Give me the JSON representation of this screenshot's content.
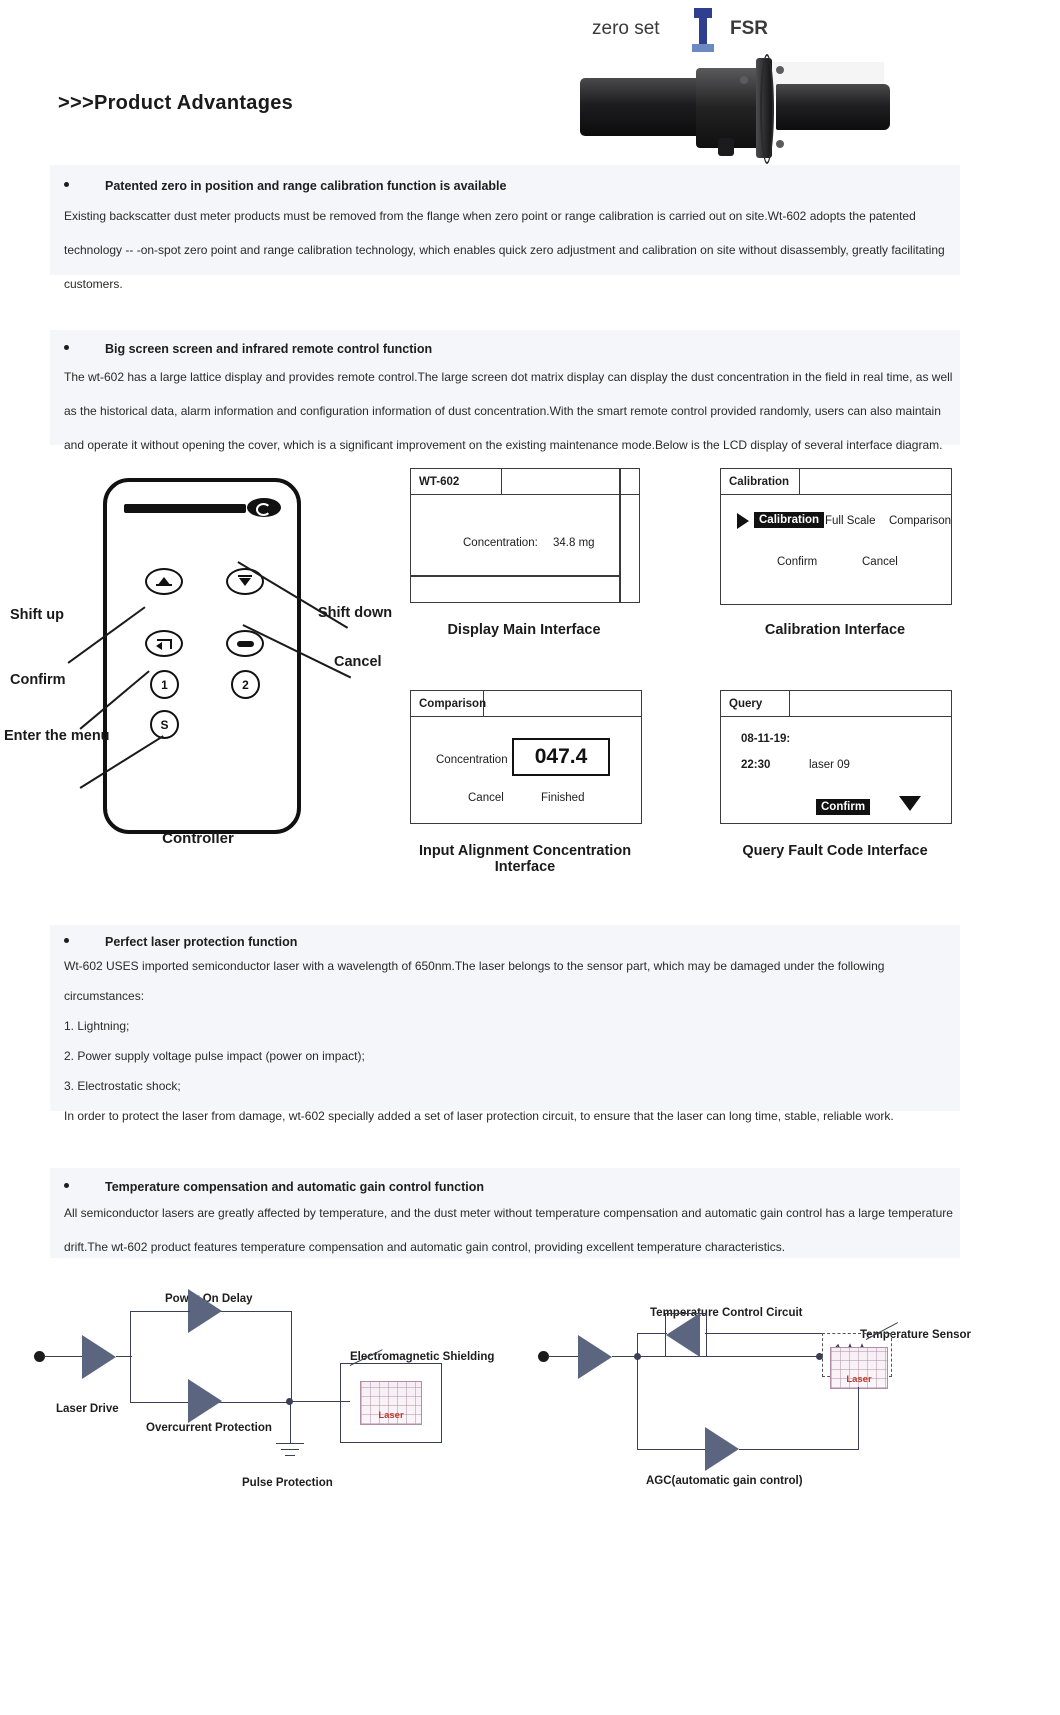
{
  "header": {
    "title": ">>>Product Advantages",
    "hero": {
      "zero_set_label": "zero set",
      "fsr_label": "FSR",
      "device_icon": "dust-meter-sensor-photo"
    }
  },
  "sections": [
    {
      "id": "patented-zero",
      "bullet": "Patented zero in position and range calibration function is available",
      "paragraphs": [
        "Existing backscatter dust meter products must be removed from the flange when zero point or range calibration is carried out on site.Wt-602 adopts the patented",
        "technology -- -on-spot zero point and range calibration technology, which enables quick zero adjustment and calibration on site without disassembly, greatly facilitating",
        "customers."
      ]
    },
    {
      "id": "big-screen",
      "bullet": "Big screen screen and infrared remote control function",
      "paragraphs": [
        "The wt-602 has a large lattice display and provides remote control.The large screen dot matrix display can display the dust concentration in the field in real time, as well",
        "as the historical data, alarm information and configuration information of dust concentration.With the smart remote control provided randomly, users can also maintain",
        "and operate it without opening the cover, which is a significant improvement on the existing maintenance mode.Below is the LCD display of several interface diagram."
      ]
    },
    {
      "id": "laser-protection",
      "bullet": "Perfect laser protection function",
      "paragraphs": [
        "Wt-602 USES imported semiconductor laser with a wavelength of 650nm.The laser belongs to the sensor part, which may be damaged under the following",
        "circumstances:",
        "1. Lightning;",
        "2. Power supply voltage pulse impact (power on impact);",
        "3. Electrostatic shock;",
        "In order to protect the laser from damage, wt-602 specially added a set of laser protection circuit, to ensure that the laser can long time, stable, reliable work."
      ]
    },
    {
      "id": "temp-compensation",
      "bullet": "Temperature compensation and automatic gain control function",
      "paragraphs": [
        "All semiconductor lasers are greatly affected by temperature, and the dust meter without temperature compensation and automatic gain control has a large temperature",
        "drift.The wt-602 product features temperature compensation and automatic gain control, providing excellent temperature characteristics."
      ]
    }
  ],
  "controller": {
    "caption": "Controller",
    "labels": {
      "shift_up": "Shift up",
      "shift_down": "Shift down",
      "confirm": "Confirm",
      "cancel": "Cancel",
      "enter_menu": "Enter the menu"
    },
    "buttons": {
      "one": "1",
      "two": "2",
      "s": "S"
    }
  },
  "lcd_screens": [
    {
      "id": "display-main",
      "tab": "WT-602",
      "caption": "Display Main Interface",
      "label": "Concentration:",
      "value": "34.8 mg"
    },
    {
      "id": "calibration",
      "tab": "Calibration",
      "caption": "Calibration Interface",
      "options": [
        "Calibration",
        "Full Scale",
        "Comparison"
      ],
      "selected": "Calibration",
      "actions": [
        "Confirm",
        "Cancel"
      ]
    },
    {
      "id": "comparison",
      "tab": "Comparison",
      "caption": "Input Alignment Concentration Interface",
      "label": "Concentration",
      "value": "047.4",
      "actions": [
        "Cancel",
        "Finished"
      ]
    },
    {
      "id": "query",
      "tab": "Query",
      "caption": "Query Fault Code Interface",
      "date": "08-11-19:",
      "time": "22:30",
      "fault_code": "laser 09",
      "action": "Confirm"
    }
  ],
  "circuits": [
    {
      "id": "laser-protection-circuit",
      "labels": {
        "power_on_delay": "Power On Delay",
        "electromagnetic_shielding": "Electromagnetic Shielding",
        "laser_drive": "Laser Drive",
        "overcurrent_protection": "Overcurrent Protection",
        "pulse_protection": "Pulse Protection",
        "laser": "Laser"
      }
    },
    {
      "id": "temperature-agc-circuit",
      "labels": {
        "temperature_control_circuit": "Temperature Control Circuit",
        "temperature_sensor": "Temperature Sensor",
        "agc": "AGC(automatic gain control)",
        "laser": "Laser"
      }
    }
  ]
}
